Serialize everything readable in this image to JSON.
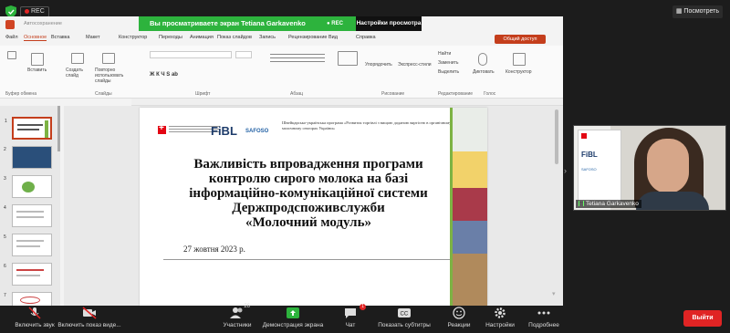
{
  "zoom": {
    "rec_label": "REC",
    "view_button": "Посмотреть",
    "share_banner": "Вы просматриваете экран Tetiana Garkavenko",
    "share_rec": "REC",
    "share_settings": "Настройки просмотра"
  },
  "ppt": {
    "autosave": "Автосохранение",
    "menu": [
      "Файл",
      "Основное",
      "Вставка",
      "Макет",
      "Конструктор",
      "Переходы",
      "Анимация",
      "Показ слайдов",
      "Запись",
      "Рецензирование",
      "Вид",
      "Справка"
    ],
    "active_menu": "Основное",
    "share_button": "Общий доступ",
    "ribbon_groups": [
      "Буфер обмена",
      "Слайды",
      "Шрифт",
      "Абзац",
      "Рисование",
      "Редактирование",
      "Голос"
    ],
    "ribbon_buttons": [
      "Вставить",
      "Создать слайд",
      "Повторно использовать слайды",
      "Упорядочить",
      "Экспресс-стили",
      "Найти",
      "Заменить",
      "Выделить",
      "Диктовать",
      "Конструктор"
    ],
    "slide_numbers": [
      "1",
      "2",
      "3",
      "4",
      "5",
      "6",
      "7"
    ]
  },
  "slide": {
    "logo_fibl": "FiBL",
    "logo_safoso": "SAFOSO",
    "program": "Швейцарсько-українська програма «Розвиток торгівлі з вищою доданою вартістю в органічному та молочному секторах України»",
    "title_lines": [
      "Важливість впровадження програми",
      "контролю сирого молока на базі",
      "інформаційно-комунікаційної системи",
      "Держпродспоживслужби",
      "«Молочний модуль»"
    ],
    "date": "27 жовтня 2023 р."
  },
  "participant": {
    "name": "Tetiana Garkavenko",
    "poster_logo": "FiBL",
    "poster_sub": "SAFOSO"
  },
  "toolbar": {
    "mic": "Включить звук",
    "video": "Включить показ виде...",
    "participants": "Участники",
    "participants_count": "26",
    "share": "Демонстрация экрана",
    "chat": "Чат",
    "chat_badge": "1",
    "cc": "Показать субтитры",
    "reactions": "Реакции",
    "settings": "Настройки",
    "more": "Подробнее",
    "leave": "Выйти"
  },
  "colors": {
    "share_green": "#2db33d",
    "ppt_accent": "#c43e1c",
    "slide_green": "#7db344",
    "leave_red": "#e02424"
  }
}
